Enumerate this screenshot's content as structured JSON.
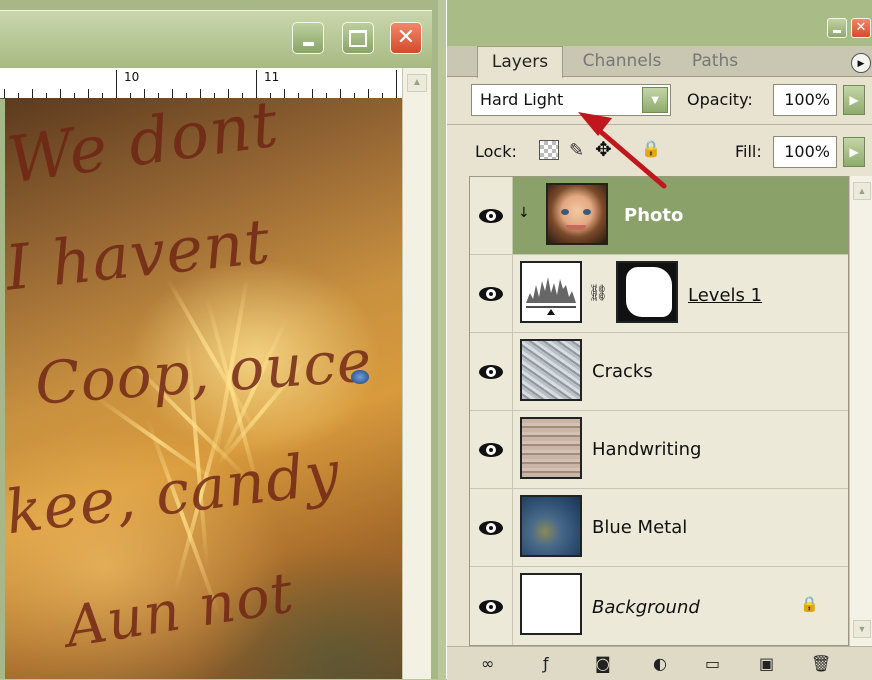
{
  "document": {
    "ruler": {
      "numbers": [
        "10",
        "11"
      ]
    },
    "canvas_text_lines": [
      "We dont",
      "I havent",
      "Coop, ouce",
      "kee, candy",
      "Aun not"
    ]
  },
  "panel": {
    "tabs": [
      {
        "label": "Layers",
        "active": true
      },
      {
        "label": "Channels",
        "active": false
      },
      {
        "label": "Paths",
        "active": false
      }
    ],
    "blend_mode": "Hard Light",
    "opacity_label": "Opacity:",
    "opacity_value": "100%",
    "lock_label": "Lock:",
    "fill_label": "Fill:",
    "fill_value": "100%",
    "layers": [
      {
        "name": "Photo",
        "selected": true,
        "visible": true
      },
      {
        "name": "Levels 1",
        "selected": false,
        "visible": true
      },
      {
        "name": "Cracks",
        "selected": false,
        "visible": true
      },
      {
        "name": "Handwriting",
        "selected": false,
        "visible": true
      },
      {
        "name": "Blue Metal",
        "selected": false,
        "visible": true
      },
      {
        "name": "Background",
        "selected": false,
        "visible": true,
        "locked": true
      }
    ]
  },
  "colors": {
    "title_green": "#a8ba83",
    "selected_layer": "#8aa16a",
    "palette_bg": "#e7e3d0",
    "close_red": "#d54a2c",
    "annotation_arrow": "#c0161e"
  }
}
